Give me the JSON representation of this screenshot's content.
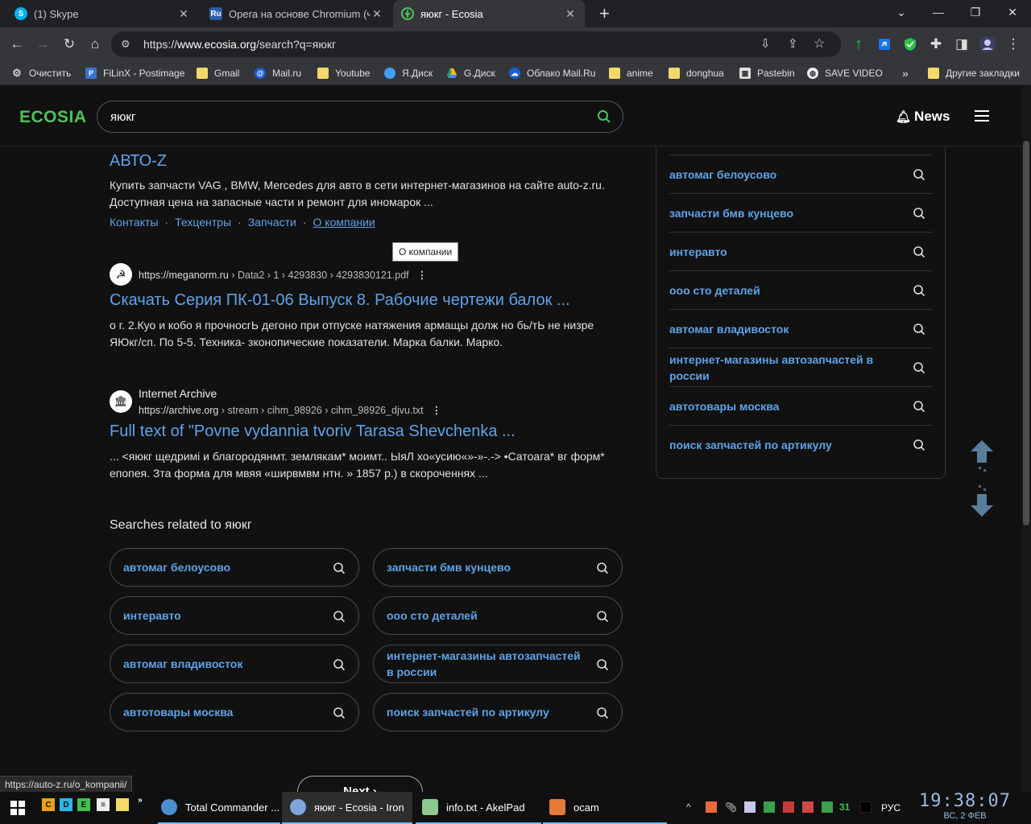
{
  "tabs": [
    {
      "label": "(1) Skype",
      "icon": "skype-icon",
      "color": "#00aff0"
    },
    {
      "label": "Opera на основе Chromium (ча",
      "icon": "ru-badge-icon",
      "color": "#2a5caa"
    },
    {
      "label": "яюкг - Ecosia",
      "icon": "ecosia-icon",
      "color": "#4ec35a"
    }
  ],
  "new_tab_label": "+",
  "address": {
    "scheme": "https://",
    "host": "www.ecosia.org",
    "path": "/search?q=яюкг"
  },
  "bookmarks": [
    {
      "label": "Очистить",
      "icon": "gear-icon"
    },
    {
      "label": "FiLinX - Postimage",
      "icon": "postimage-icon"
    },
    {
      "label": "Gmail",
      "icon": "folder-icon"
    },
    {
      "label": "Mail.ru",
      "icon": "at-icon"
    },
    {
      "label": "Youtube",
      "icon": "folder-icon"
    },
    {
      "label": "Я.Диск",
      "icon": "yadisk-icon"
    },
    {
      "label": "G.Диск",
      "icon": "gdrive-icon"
    },
    {
      "label": "Облако Mail.Ru",
      "icon": "cloud-icon"
    },
    {
      "label": "anime",
      "icon": "folder-icon"
    },
    {
      "label": "donghua",
      "icon": "folder-icon"
    },
    {
      "label": "Pastebin",
      "icon": "pastebin-icon"
    },
    {
      "label": "SAVE VIDEO",
      "icon": "globe-icon"
    },
    {
      "label": "»",
      "icon": ""
    },
    {
      "label": "Другие закладки",
      "icon": "folder-icon"
    }
  ],
  "header": {
    "logo": "ECOSIA",
    "query": "яюкг",
    "news": "News"
  },
  "results": [
    {
      "title": "АВТО-Z",
      "snippet": "Купить запчасти VAG , BMW, Mercedes для авто в сети интернет-магазинов на сайте auto-z.ru. Доступная цена на запасные части и ремонт для иномарок ...",
      "sitelinks": [
        "Контакты",
        "Техцентры",
        "Запчасти",
        "О компании"
      ]
    },
    {
      "source_url": "https://meganorm.ru",
      "source_path": " › Data2 › 1 › 4293830 › 4293830121.pdf",
      "title": "Скачать Серия ПК-01-06 Выпуск 8. Рабочие чертежи балок ...",
      "snippet": "о г. 2.Куо и кобо я прочносгЬ дегоно при отпуске натяжения армащы долж но бь/тЬ не низре ЯЮкг/сп. По 5-5. Техника- зконопические показатели. Марка балки. Марко."
    },
    {
      "source_name": "Internet Archive",
      "source_url": "https://archive.org",
      "source_path": " › stream › cihm_98926 › cihm_98926_djvu.txt",
      "title": "Full text of \"Povne vydannia tvoriv Tarasa Shevchenka ...",
      "snippet": "... <яюкг щедримі и благородянмт. землякам* моимт.. ЫяЛ хо«усию«»-»-.-> •Сатоага* вг форм* епопея. Зта форма для мвяя «ширвмвм нтн. » 1857 р.) в скороченнях ..."
    }
  ],
  "tooltip": "О компании",
  "related_heading": "Searches related to яюкг",
  "related": [
    "автомаг белоусово",
    "запчасти бмв кунцево",
    "интеравто",
    "ооо сто деталей",
    "автомаг владивосток",
    "интернет-магазины автозапчастей в россии",
    "автотовары москва",
    "поиск запчастей по артикулу"
  ],
  "side_related": [
    "автомаг белоусово",
    "запчасти бмв кунцево",
    "интеравто",
    "ооо сто деталей",
    "автомаг владивосток",
    "интернет-магазины автозапчастей в россии",
    "автотовары москва",
    "поиск запчастей по артикулу"
  ],
  "next_label": "Next",
  "status_url": "https://auto-z.ru/o_kompanii/",
  "taskbar": {
    "apps": [
      {
        "label": "Total Commander ...",
        "icon": "total-commander-icon"
      },
      {
        "label": "яюкг - Ecosia - Iron",
        "icon": "iron-browser-icon"
      },
      {
        "label": "info.txt - AkelPad",
        "icon": "akelpad-icon"
      },
      {
        "label": "ocam",
        "icon": "ocam-icon"
      }
    ],
    "quicklaunch": [
      "C",
      "D",
      "E"
    ],
    "lang": "РУС",
    "time": "19:38:07",
    "date": "ВС, 2  ФЕВ",
    "tray_num": "31"
  },
  "colors": {
    "accent": "#5fa3e8",
    "logo": "#4ec35a",
    "background": "#111111"
  }
}
